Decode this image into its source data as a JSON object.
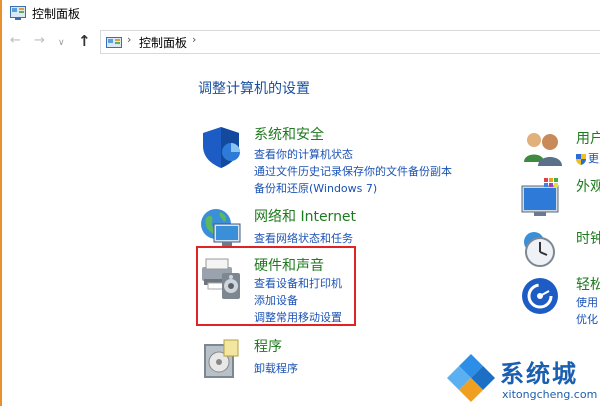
{
  "window": {
    "title": "控制面板"
  },
  "nav": {
    "back": "←",
    "forward": "→",
    "recent": "∨",
    "up": "↑",
    "breadcrumb": "控制面板",
    "sep": "›"
  },
  "main": {
    "heading": "调整计算机的设置",
    "categories": [
      {
        "title": "系统和安全",
        "links": [
          "查看你的计算机状态",
          "通过文件历史记录保存你的文件备份副本",
          "备份和还原(Windows 7)"
        ]
      },
      {
        "title": "网络和 Internet",
        "links": [
          "查看网络状态和任务"
        ]
      },
      {
        "title": "硬件和声音",
        "links": [
          "查看设备和打印机",
          "添加设备",
          "调整常用移动设置"
        ]
      },
      {
        "title": "程序",
        "links": [
          "卸载程序"
        ]
      }
    ],
    "right_categories": [
      {
        "title": "用户",
        "link": "更"
      },
      {
        "title": "外观"
      },
      {
        "title": "时钟"
      },
      {
        "title": "轻松",
        "links": [
          "使用",
          "优化"
        ]
      }
    ]
  },
  "watermark": {
    "text": "系统城",
    "url": "xitongcheng.com"
  },
  "colors": {
    "heading": "#1a4fa0",
    "category_title": "#1e7a1e",
    "link": "#1a52b5",
    "highlight": "#e02424"
  }
}
